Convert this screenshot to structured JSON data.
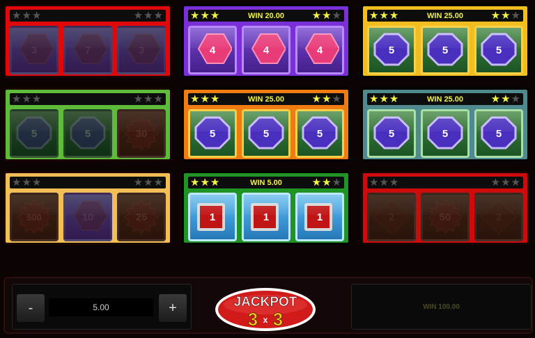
{
  "panels": [
    {
      "id": "p1",
      "active": false,
      "frame": "#e00808",
      "win": "",
      "cells": [
        {
          "symbol": "3",
          "shape": "hex"
        },
        {
          "symbol": "7",
          "shape": "hex"
        },
        {
          "symbol": "3",
          "shape": "hex"
        }
      ]
    },
    {
      "id": "p2",
      "active": true,
      "frame": "#7a2fd8",
      "win": "WIN 20.00",
      "cells": [
        {
          "symbol": "4",
          "shape": "hex"
        },
        {
          "symbol": "4",
          "shape": "hex"
        },
        {
          "symbol": "4",
          "shape": "hex"
        }
      ]
    },
    {
      "id": "p3",
      "active": true,
      "frame": "#f2bd1e",
      "win": "WIN 25.00",
      "cells": [
        {
          "symbol": "5",
          "shape": "oct"
        },
        {
          "symbol": "5",
          "shape": "oct"
        },
        {
          "symbol": "5",
          "shape": "oct"
        }
      ]
    },
    {
      "id": "p4",
      "active": false,
      "frame": "#5fbb3a",
      "win": "",
      "cells": [
        {
          "symbol": "5",
          "shape": "oct"
        },
        {
          "symbol": "5",
          "shape": "oct"
        },
        {
          "symbol": "30",
          "shape": "burst"
        }
      ]
    },
    {
      "id": "p5",
      "active": true,
      "frame": "#f07b12",
      "win": "WIN 25.00",
      "cells": [
        {
          "symbol": "5",
          "shape": "oct"
        },
        {
          "symbol": "5",
          "shape": "oct"
        },
        {
          "symbol": "5",
          "shape": "oct"
        }
      ]
    },
    {
      "id": "p6",
      "active": true,
      "frame": "#4f8a8f",
      "win": "WIN 25.00",
      "cells": [
        {
          "symbol": "5",
          "shape": "oct"
        },
        {
          "symbol": "5",
          "shape": "oct"
        },
        {
          "symbol": "5",
          "shape": "oct"
        }
      ]
    },
    {
      "id": "p7",
      "active": false,
      "frame": "#f2be55",
      "win": "",
      "cells": [
        {
          "symbol": "500",
          "shape": "burst"
        },
        {
          "symbol": "10",
          "shape": "hex"
        },
        {
          "symbol": "25",
          "shape": "burst"
        }
      ]
    },
    {
      "id": "p8",
      "active": true,
      "frame": "#1f9424",
      "win": "WIN 5.00",
      "cells": [
        {
          "symbol": "1",
          "shape": "square"
        },
        {
          "symbol": "1",
          "shape": "square"
        },
        {
          "symbol": "1",
          "shape": "square"
        }
      ]
    },
    {
      "id": "p9",
      "active": false,
      "frame": "#cf0a0a",
      "win": "",
      "cells": [
        {
          "symbol": "2",
          "shape": "diamond"
        },
        {
          "symbol": "50",
          "shape": "burst"
        },
        {
          "symbol": "2",
          "shape": "diamond"
        }
      ]
    }
  ],
  "bet": {
    "minus_label": "-",
    "value": "5.00",
    "plus_label": "+"
  },
  "logo": {
    "line1": "JACKPOT",
    "line2_a": "3",
    "line2_x": "x",
    "line2_b": "3"
  },
  "total_win": "WIN 100.00",
  "colors": {
    "star_on": "#f2f247",
    "star_off": "#555555",
    "background": "#0c0303"
  }
}
